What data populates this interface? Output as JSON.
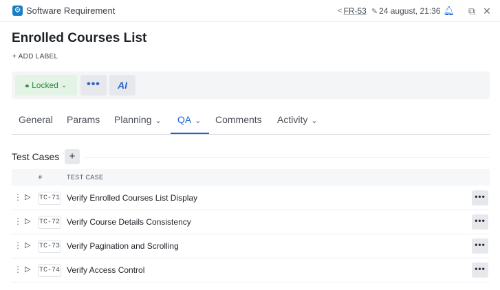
{
  "header": {
    "app_title": "Software Requirement",
    "app_icon": "gear-icon",
    "ref_id": "FR-53",
    "date": "24 august, 21:36"
  },
  "page": {
    "title": "Enrolled Courses List",
    "add_label": "+ ADD LABEL"
  },
  "actions": {
    "status_label": "Locked",
    "more_label": "•••",
    "ai_label": "AI",
    "status_color": "#2a8a3e",
    "accent_color": "#1a64d6"
  },
  "tabs": [
    {
      "label": "General",
      "active": false
    },
    {
      "label": "Params",
      "active": false
    },
    {
      "label": "Planning",
      "active": false,
      "dropdown": true
    },
    {
      "label": "QA",
      "active": true,
      "dropdown": true
    },
    {
      "label": "Comments",
      "active": false
    },
    {
      "label": "Activity",
      "active": false,
      "dropdown": true
    }
  ],
  "test_cases": {
    "title": "Test Cases",
    "add_label": "+",
    "columns": [
      "#",
      "TEST CASE"
    ],
    "rows": [
      {
        "id": "TC-71",
        "name": "Verify Enrolled Courses List Display"
      },
      {
        "id": "TC-72",
        "name": "Verify Course Details Consistency"
      },
      {
        "id": "TC-73",
        "name": "Verify Pagination and Scrolling"
      },
      {
        "id": "TC-74",
        "name": "Verify Access Control"
      }
    ],
    "row_more_label": "•••"
  }
}
